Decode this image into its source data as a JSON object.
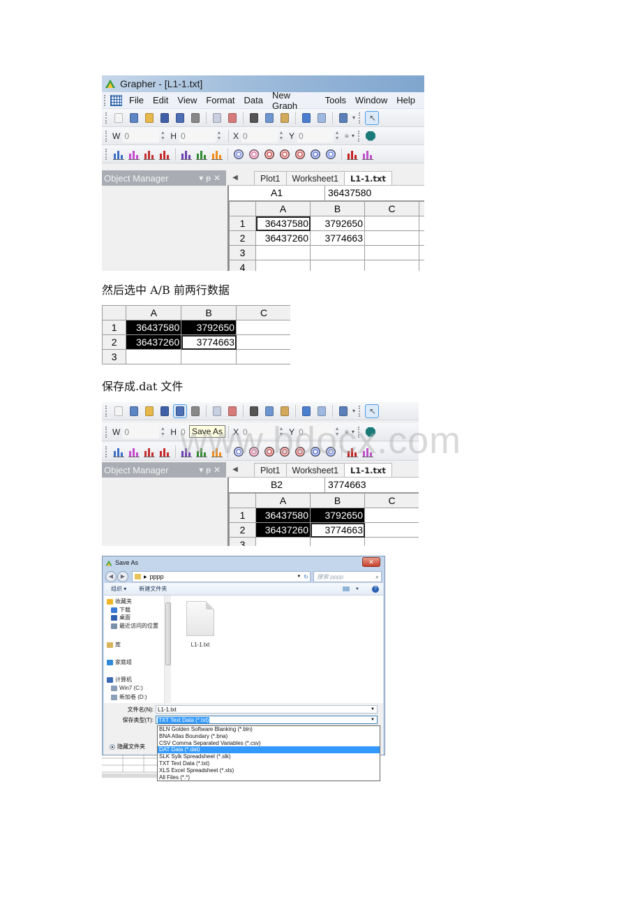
{
  "app": {
    "title": "Grapher - [L1-1.txt]",
    "menu": [
      "File",
      "Edit",
      "View",
      "Format",
      "Data",
      "New Graph",
      "Tools",
      "Window",
      "Help"
    ],
    "toolbar_standard_icons": [
      "new-plot-icon",
      "new-worksheet-icon",
      "open-icon",
      "save-icon",
      "save-as-icon",
      "print-icon",
      "import-icon",
      "export-icon",
      "cut-icon",
      "copy-icon",
      "paste-icon",
      "undo-icon",
      "redo-icon",
      "whats-this-icon",
      "select-pointer-icon"
    ],
    "position_fields": [
      {
        "label": "W",
        "value": "0"
      },
      {
        "label": "H",
        "value": "0"
      },
      {
        "label": "X",
        "value": "0"
      },
      {
        "label": "Y",
        "value": "0"
      }
    ],
    "graph_toolbar_icons": [
      "line-plot-icon",
      "scatter-plot-icon",
      "step-plot-icon",
      "function-plot-icon",
      "bar-chart-icon",
      "floating-bar-icon",
      "histogram-icon",
      "polar-plot-icon",
      "pie-chart-icon",
      "rose-diagram-icon",
      "wind-chart-icon",
      "ternary-plot-icon",
      "polar-vector-icon",
      "polar-scatter-icon",
      "box-whisker-icon",
      "bubble-plot-icon"
    ],
    "object_manager": {
      "title": "Object Manager",
      "controls": [
        "▾",
        "ᵽ",
        "✕"
      ]
    },
    "tabs": [
      {
        "label": "Plot1",
        "active": false
      },
      {
        "label": "Worksheet1",
        "active": false
      },
      {
        "label": "L1-1.txt",
        "active": true
      }
    ]
  },
  "screenshot1": {
    "cell_ref": "A1",
    "cell_value": "36437580",
    "columns": [
      "A",
      "B",
      "C"
    ],
    "rows": [
      {
        "n": "1",
        "cells": [
          "36437580",
          "3792650",
          ""
        ]
      },
      {
        "n": "2",
        "cells": [
          "36437260",
          "3774663",
          ""
        ]
      },
      {
        "n": "3",
        "cells": [
          "",
          "",
          ""
        ]
      },
      {
        "n": "4",
        "cells": [
          "",
          "",
          ""
        ]
      }
    ]
  },
  "caption1": "然后选中 A/B 前两行数据",
  "screenshot2": {
    "columns": [
      "A",
      "B",
      "C"
    ],
    "rows": [
      {
        "n": "1",
        "cells": [
          "36437580",
          "3792650",
          ""
        ]
      },
      {
        "n": "2",
        "cells": [
          "36437260",
          "3774663",
          ""
        ]
      },
      {
        "n": "3",
        "cells": [
          "",
          "",
          ""
        ]
      }
    ]
  },
  "caption2": "保存成.dat 文件",
  "screenshot3": {
    "tooltip": "Save As",
    "watermark": "www.bdocx.com",
    "cell_ref": "B2",
    "cell_value": "3774663",
    "columns": [
      "A",
      "B",
      "C"
    ],
    "rows": [
      {
        "n": "1",
        "cells": [
          "36437580",
          "3792650",
          ""
        ]
      },
      {
        "n": "2",
        "cells": [
          "36437260",
          "3774663",
          ""
        ]
      },
      {
        "n": "3",
        "cells": [
          "",
          "",
          ""
        ]
      }
    ]
  },
  "save_dialog": {
    "title": "Save As",
    "close": "✕",
    "path": "pppp",
    "search_placeholder": "搜索 pppp",
    "organize": "组织 ▾",
    "new_folder": "新建文件夹",
    "nav": [
      {
        "label": "收藏夹",
        "icon": "star-icon"
      },
      {
        "label": "下载",
        "icon": "downloads-icon"
      },
      {
        "label": "桌面",
        "icon": "desktop-icon"
      },
      {
        "label": "最近访问的位置",
        "icon": "recent-places-icon"
      },
      {
        "label": "库",
        "icon": "library-icon"
      },
      {
        "label": "家庭组",
        "icon": "homegroup-icon"
      },
      {
        "label": "计算机",
        "icon": "computer-icon"
      },
      {
        "label": "Win7 (C:)",
        "icon": "drive-icon"
      },
      {
        "label": "新加卷 (D:)",
        "icon": "drive-icon"
      }
    ],
    "files": [
      {
        "name": "L1-1.txt"
      }
    ],
    "filename_label": "文件名(N):",
    "filename_value": "L1-1.txt",
    "filetype_label": "保存类型(T):",
    "filetype_value": "TXT Text Data (*.txt)",
    "hide_folders": "隐藏文件夹",
    "filetype_options": [
      {
        "label": "BLN Golden Software Blanking (*.bln)",
        "highlighted": false
      },
      {
        "label": "BNA Atlas Boundary (*.bna)",
        "highlighted": false
      },
      {
        "label": "CSV Comma Separated Variables (*.csv)",
        "highlighted": false
      },
      {
        "label": "DAT Data (*.dat)",
        "highlighted": true
      },
      {
        "label": "SLK Sylk Spreadsheet (*.slk)",
        "highlighted": false
      },
      {
        "label": "TXT Text Data (*.txt)",
        "highlighted": false
      },
      {
        "label": "XLS Excel Spreadsheet (*.xls)",
        "highlighted": false
      },
      {
        "label": "All Files (*.*)",
        "highlighted": false
      }
    ]
  },
  "colors": {
    "selection": "#000000",
    "dropdown_highlight": "#3399ff",
    "object_manager_header": "#a9adb3",
    "shape_tool": "#1a7a7a"
  }
}
